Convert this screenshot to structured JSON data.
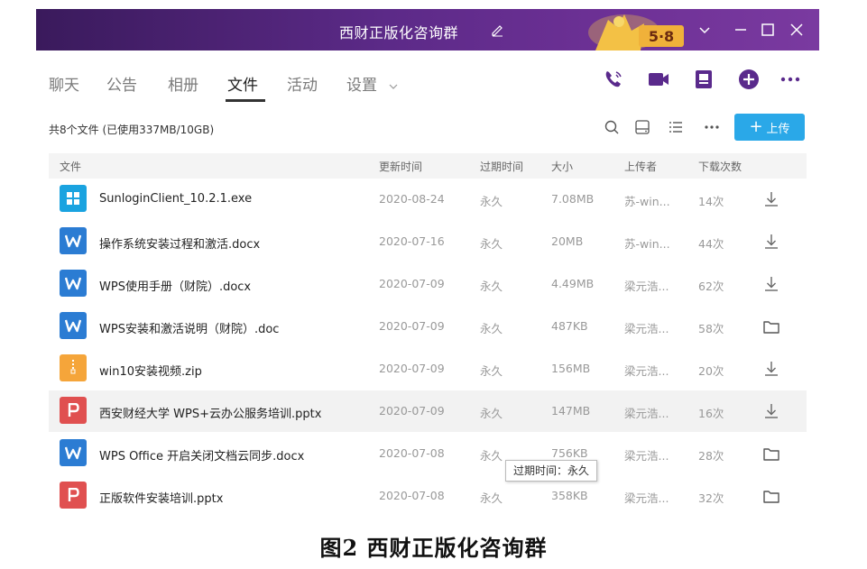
{
  "window": {
    "title": "西财正版化咨询群",
    "promo_text": "5·8"
  },
  "tabs": [
    {
      "label": "聊天"
    },
    {
      "label": "公告"
    },
    {
      "label": "相册"
    },
    {
      "label": "文件",
      "active": true
    },
    {
      "label": "活动"
    },
    {
      "label": "设置"
    }
  ],
  "header_actions": [
    "phone-icon",
    "video-icon",
    "screen-share-icon",
    "add-icon",
    "more-icon"
  ],
  "toolbar": {
    "summary": "共8个文件 (已使用337MB/10GB)",
    "upload_label": "上传"
  },
  "table": {
    "columns": [
      "文件",
      "更新时间",
      "过期时间",
      "大小",
      "上传者",
      "下载次数"
    ],
    "rows": [
      {
        "icon": "exe",
        "name": "SunloginClient_10.2.1.exe",
        "updated": "2020-08-24",
        "expires": "永久",
        "size": "7.08MB",
        "uploader": "苏-win...",
        "downloads": "14次",
        "action": "download"
      },
      {
        "icon": "word",
        "name": "操作系统安装过程和激活.docx",
        "updated": "2020-07-16",
        "expires": "永久",
        "size": "20MB",
        "uploader": "苏-win...",
        "downloads": "44次",
        "action": "download"
      },
      {
        "icon": "word",
        "name": "WPS使用手册（财院）.docx",
        "updated": "2020-07-09",
        "expires": "永久",
        "size": "4.49MB",
        "uploader": "梁元浩...",
        "downloads": "62次",
        "action": "download"
      },
      {
        "icon": "word",
        "name": "WPS安装和激活说明（财院）.doc",
        "updated": "2020-07-09",
        "expires": "永久",
        "size": "487KB",
        "uploader": "梁元浩...",
        "downloads": "58次",
        "action": "folder"
      },
      {
        "icon": "zip",
        "name": "win10安装视频.zip",
        "updated": "2020-07-09",
        "expires": "永久",
        "size": "156MB",
        "uploader": "梁元浩...",
        "downloads": "20次",
        "action": "download"
      },
      {
        "icon": "ppt",
        "name": "西安财经大学 WPS+云办公服务培训.pptx",
        "updated": "2020-07-09",
        "expires": "永久",
        "size": "147MB",
        "uploader": "梁元浩...",
        "downloads": "16次",
        "action": "download",
        "highlight": true
      },
      {
        "icon": "word",
        "name": "WPS Office 开启关闭文档云同步.docx",
        "updated": "2020-07-08",
        "expires": "永久",
        "size": "756KB",
        "uploader": "梁元浩...",
        "downloads": "28次",
        "action": "folder"
      },
      {
        "icon": "ppt",
        "name": "正版软件安装培训.pptx",
        "updated": "2020-07-08",
        "expires": "永久",
        "size": "358KB",
        "uploader": "梁元浩...",
        "downloads": "32次",
        "action": "folder"
      }
    ]
  },
  "tooltip": "过期时间：永久",
  "caption": "图2   西财正版化咨询群",
  "colors": {
    "titlebar": "#5c2a88",
    "accent_blue": "#2aa8e8",
    "word": "#2b7cd3",
    "exe": "#1aa3e0",
    "zip": "#f5a53a",
    "ppt": "#e05050",
    "action_purple": "#5a2a8c"
  }
}
